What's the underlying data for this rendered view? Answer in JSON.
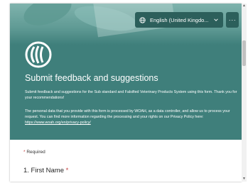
{
  "colors": {
    "header_teal": "#3f7f7b",
    "button_dark_teal": "#2c5f5b",
    "required_red": "#c43e3e"
  },
  "header": {
    "language_selector": {
      "icon": "globe-icon",
      "label": "English (United Kingdo...",
      "chevron_icon": "chevron-down-icon"
    },
    "more_button_label": "···",
    "logo_icon": "woah-logo-icon",
    "title": "Submit feedback and suggestions",
    "description_1": "Submit feedback and suggestions for the Sub standard and Falsified Veterinary Products System using this form. Thank you for your recommendations!",
    "description_2": "The personal data that you provide with this form is processed by WOAH, as a data controller, and allow us to process your request. You can find more information regarding the processing and your rights on our Privacy Policy here:",
    "privacy_link": "https://www.woah.org/en/privacy-policy/"
  },
  "form": {
    "required_marker": "*",
    "required_label": "Required",
    "question_1": {
      "number_label": "1. First Name",
      "required_star": "*"
    }
  },
  "scrollbar": {
    "up_icon": "▲",
    "down_icon": "▼"
  }
}
